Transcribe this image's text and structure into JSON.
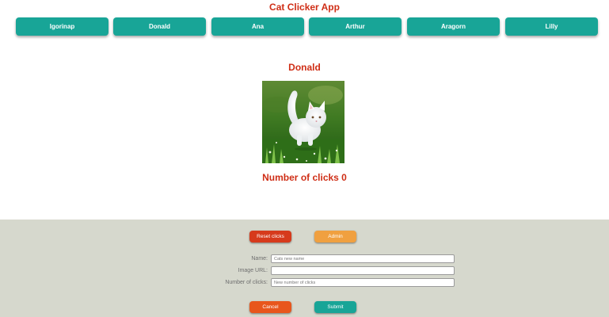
{
  "app": {
    "title": "Cat Clicker App"
  },
  "cats": [
    {
      "label": "Igorinap"
    },
    {
      "label": "Donald"
    },
    {
      "label": "Ana"
    },
    {
      "label": "Arthur"
    },
    {
      "label": "Aragorn"
    },
    {
      "label": "Lilly"
    }
  ],
  "selected_cat": {
    "name": "Donald",
    "clicks_text": "Number of clicks 0"
  },
  "admin": {
    "reset_label": "Reset clicks",
    "admin_label": "Admin",
    "fields": [
      {
        "label": "Name:",
        "placeholder": "Cats new name"
      },
      {
        "label": "Image URL:",
        "placeholder": ""
      },
      {
        "label": "Number of clicks:",
        "placeholder": "New number of clicks"
      }
    ],
    "cancel_label": "Cancel",
    "submit_label": "Submit"
  },
  "colors": {
    "accent_teal": "#18a597",
    "title_red": "#cf2e16",
    "reset_red": "#d63a1c",
    "admin_orange": "#f0a040",
    "cancel_orange": "#e8561c",
    "panel_bg": "#d6d8cd"
  }
}
